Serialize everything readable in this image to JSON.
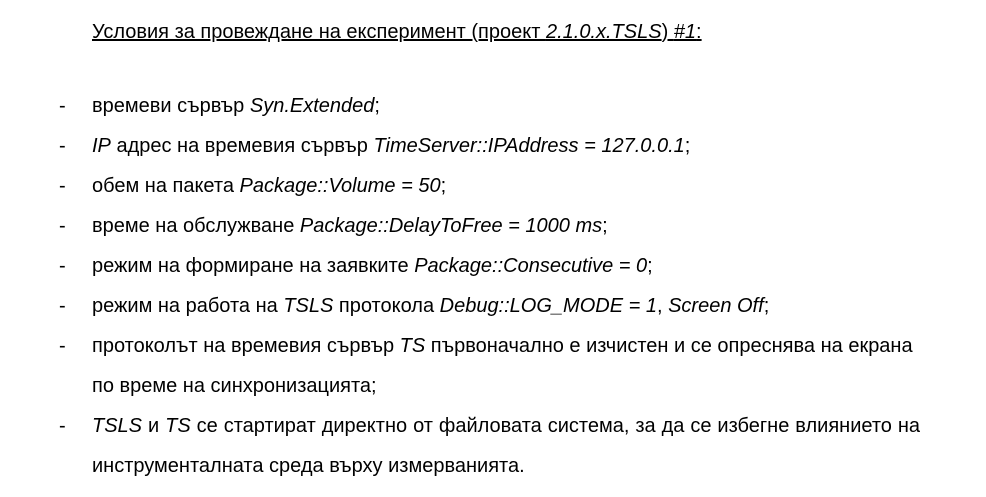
{
  "heading": {
    "p1": "Условия за провеждане на експеримент (проект ",
    "p2": "2.1.0.x.TSLS",
    "p3": ") ",
    "p4": "#1",
    "p5": ":"
  },
  "bullet": "-",
  "items": [
    {
      "p1": "времеви сървър ",
      "p2": "Syn.Extended",
      "p3": ";"
    },
    {
      "p1": "IP",
      "p2": " адрес на времевия сървър ",
      "p3": "TimeServer::IPAddress = 127.0.0.1",
      "p4": ";"
    },
    {
      "p1": "обем на пакета ",
      "p2": "Package::Volume = 50",
      "p3": ";"
    },
    {
      "p1": "време на обслужване ",
      "p2": "Package::DelayToFree = 1000 ms",
      "p3": ";"
    },
    {
      "p1": "режим на формиране на заявките ",
      "p2": "Package::Consecutive = 0",
      "p3": ";"
    },
    {
      "p1": "режим на работа на ",
      "p2": "TSLS",
      "p3": " протокола ",
      "p4": "Debug::LOG_MODE = 1",
      "p5": ", ",
      "p6": "Screen Off",
      "p7": ";"
    },
    {
      "p1": "протоколът на времевия сървър ",
      "p2": "TS",
      "p3": " първоначално е изчистен и се опреснява на екрана по време на синхронизацията;"
    },
    {
      "p1": "TSLS",
      "p2": " и ",
      "p3": "TS",
      "p4": " се стартират директно от файловата система, за да се избегне влиянието на инструменталната среда върху измерванията."
    }
  ]
}
